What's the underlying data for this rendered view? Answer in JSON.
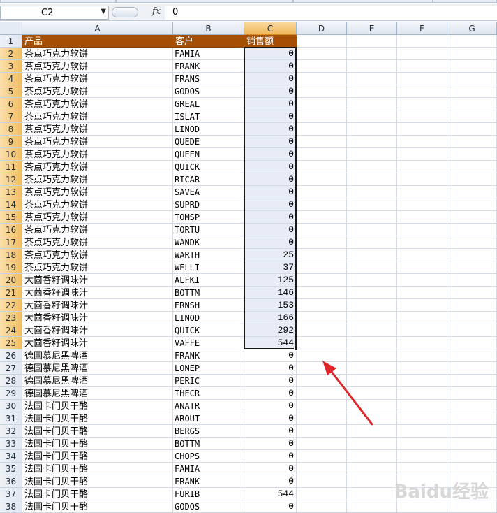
{
  "formula_bar": {
    "cell_ref": "C2",
    "fx_label": "fx",
    "formula": "0"
  },
  "columns": [
    "A",
    "B",
    "C",
    "D",
    "E",
    "F",
    "G"
  ],
  "header_row": {
    "row": "1",
    "product": "产品",
    "customer": "客户",
    "sales": "销售额"
  },
  "rows": [
    {
      "row": "2",
      "product": "茶点巧克力软饼",
      "customer": "FAMIA",
      "sales": "0"
    },
    {
      "row": "3",
      "product": "茶点巧克力软饼",
      "customer": "FRANK",
      "sales": "0"
    },
    {
      "row": "4",
      "product": "茶点巧克力软饼",
      "customer": "FRANS",
      "sales": "0"
    },
    {
      "row": "5",
      "product": "茶点巧克力软饼",
      "customer": "GODOS",
      "sales": "0"
    },
    {
      "row": "6",
      "product": "茶点巧克力软饼",
      "customer": "GREAL",
      "sales": "0"
    },
    {
      "row": "7",
      "product": "茶点巧克力软饼",
      "customer": "ISLAT",
      "sales": "0"
    },
    {
      "row": "8",
      "product": "茶点巧克力软饼",
      "customer": "LINOD",
      "sales": "0"
    },
    {
      "row": "9",
      "product": "茶点巧克力软饼",
      "customer": "QUEDE",
      "sales": "0"
    },
    {
      "row": "10",
      "product": "茶点巧克力软饼",
      "customer": "QUEEN",
      "sales": "0"
    },
    {
      "row": "11",
      "product": "茶点巧克力软饼",
      "customer": "QUICK",
      "sales": "0"
    },
    {
      "row": "12",
      "product": "茶点巧克力软饼",
      "customer": "RICAR",
      "sales": "0"
    },
    {
      "row": "13",
      "product": "茶点巧克力软饼",
      "customer": "SAVEA",
      "sales": "0"
    },
    {
      "row": "14",
      "product": "茶点巧克力软饼",
      "customer": "SUPRD",
      "sales": "0"
    },
    {
      "row": "15",
      "product": "茶点巧克力软饼",
      "customer": "TOMSP",
      "sales": "0"
    },
    {
      "row": "16",
      "product": "茶点巧克力软饼",
      "customer": "TORTU",
      "sales": "0"
    },
    {
      "row": "17",
      "product": "茶点巧克力软饼",
      "customer": "WANDK",
      "sales": "0"
    },
    {
      "row": "18",
      "product": "茶点巧克力软饼",
      "customer": "WARTH",
      "sales": "25"
    },
    {
      "row": "19",
      "product": "茶点巧克力软饼",
      "customer": "WELLI",
      "sales": "37"
    },
    {
      "row": "20",
      "product": "大茴香籽调味汁",
      "customer": "ALFKI",
      "sales": "125"
    },
    {
      "row": "21",
      "product": "大茴香籽调味汁",
      "customer": "BOTTM",
      "sales": "146"
    },
    {
      "row": "22",
      "product": "大茴香籽调味汁",
      "customer": "ERNSH",
      "sales": "153"
    },
    {
      "row": "23",
      "product": "大茴香籽调味汁",
      "customer": "LINOD",
      "sales": "166"
    },
    {
      "row": "24",
      "product": "大茴香籽调味汁",
      "customer": "QUICK",
      "sales": "292"
    },
    {
      "row": "25",
      "product": "大茴香籽调味汁",
      "customer": "VAFFE",
      "sales": "544"
    },
    {
      "row": "26",
      "product": "德国慕尼黑啤酒",
      "customer": "FRANK",
      "sales": "0"
    },
    {
      "row": "27",
      "product": "德国慕尼黑啤酒",
      "customer": "LONEP",
      "sales": "0"
    },
    {
      "row": "28",
      "product": "德国慕尼黑啤酒",
      "customer": "PERIC",
      "sales": "0"
    },
    {
      "row": "29",
      "product": "德国慕尼黑啤酒",
      "customer": "THECR",
      "sales": "0"
    },
    {
      "row": "30",
      "product": "法国卡门贝干酪",
      "customer": "ANATR",
      "sales": "0"
    },
    {
      "row": "31",
      "product": "法国卡门贝干酪",
      "customer": "AROUT",
      "sales": "0"
    },
    {
      "row": "32",
      "product": "法国卡门贝干酪",
      "customer": "BERGS",
      "sales": "0"
    },
    {
      "row": "33",
      "product": "法国卡门贝干酪",
      "customer": "BOTTM",
      "sales": "0"
    },
    {
      "row": "34",
      "product": "法国卡门贝干酪",
      "customer": "CHOPS",
      "sales": "0"
    },
    {
      "row": "35",
      "product": "法国卡门贝干酪",
      "customer": "FAMIA",
      "sales": "0"
    },
    {
      "row": "36",
      "product": "法国卡门贝干酪",
      "customer": "FRANK",
      "sales": "0"
    },
    {
      "row": "37",
      "product": "法国卡门贝干酪",
      "customer": "FURIB",
      "sales": "544"
    },
    {
      "row": "38",
      "product": "法国卡门贝干酪",
      "customer": "GODOS",
      "sales": "0"
    }
  ],
  "selection": {
    "from_row": "2",
    "to_row": "25",
    "column": "C"
  },
  "colors": {
    "header_fill": "#a54f04",
    "header_text": "#ffffff",
    "selection_fill": "#e8ecf7",
    "arrow": "#e0262b"
  },
  "watermark": "Baidu经验",
  "icons": [
    "dropdown-arrow-icon",
    "fx-icon",
    "annotation-arrow-icon",
    "fill-handle-icon"
  ]
}
